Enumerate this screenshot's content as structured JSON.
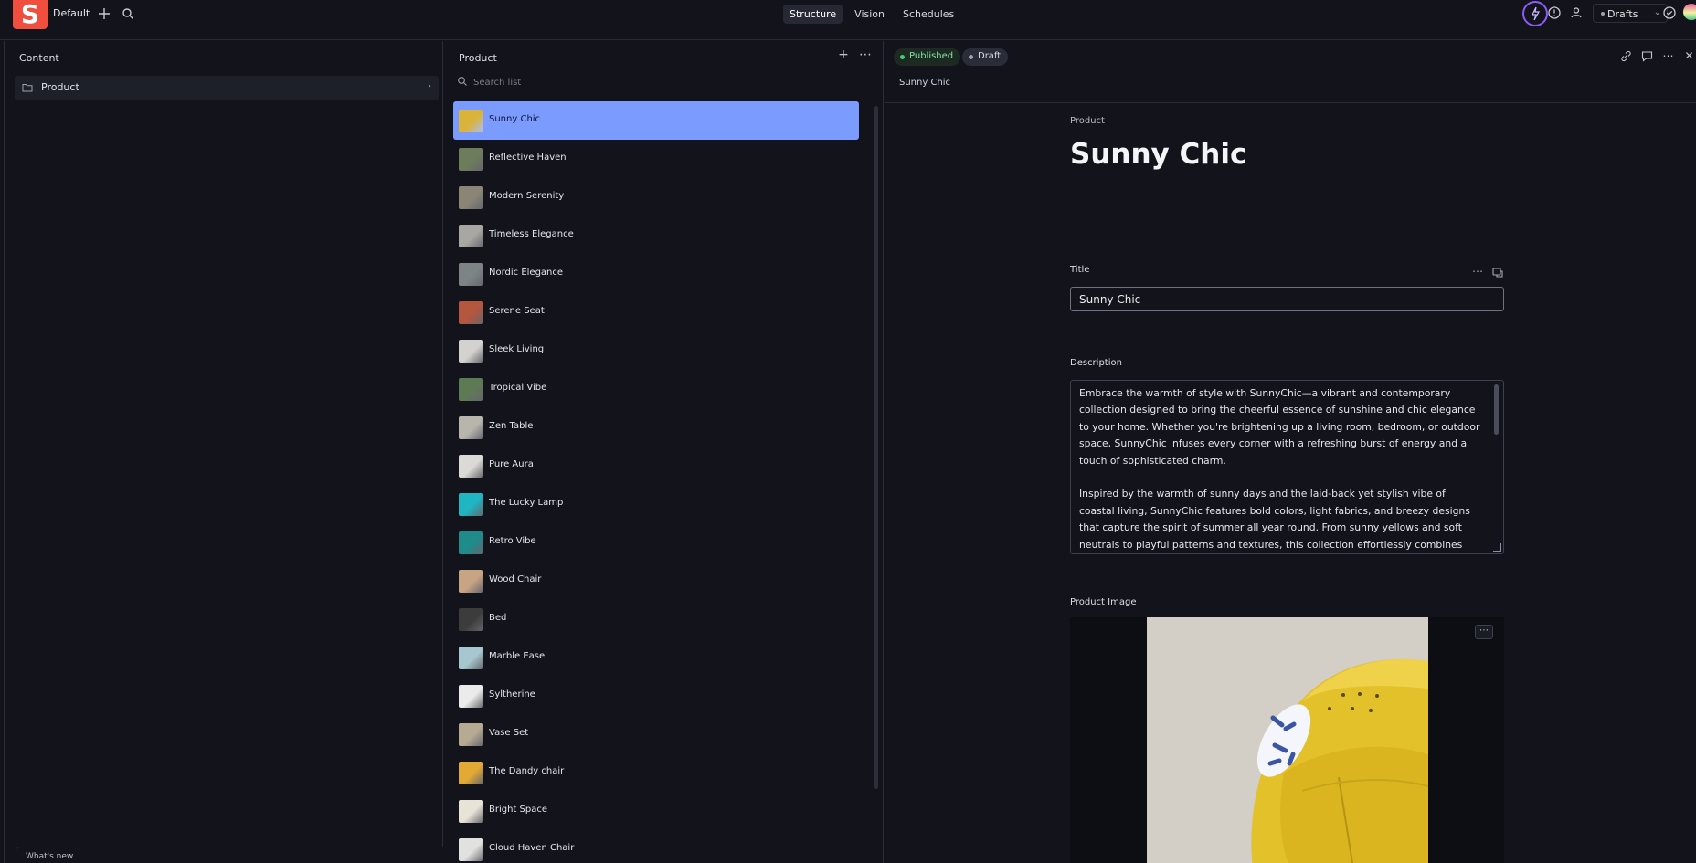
{
  "topbar": {
    "logo_letter": "S",
    "workspace": "Default",
    "tools": [
      {
        "label": "Structure",
        "active": true
      },
      {
        "label": "Vision",
        "active": false
      },
      {
        "label": "Schedules",
        "active": false
      }
    ],
    "perspective": "Drafts"
  },
  "content_pane": {
    "title": "Content",
    "items": [
      {
        "label": "Product"
      }
    ],
    "whats_new": "What's new"
  },
  "list_pane": {
    "title": "Product",
    "search_placeholder": "Search list",
    "documents": [
      {
        "label": "Sunny Chic",
        "selected": true,
        "thumb": "#d9b33a"
      },
      {
        "label": "Reflective Haven",
        "selected": false,
        "thumb": "#6d7d5c"
      },
      {
        "label": "Modern Serenity",
        "selected": false,
        "thumb": "#8a8577"
      },
      {
        "label": "Timeless Elegance",
        "selected": false,
        "thumb": "#a9a7a2"
      },
      {
        "label": "Nordic Elegance",
        "selected": false,
        "thumb": "#7c8486"
      },
      {
        "label": "Serene Seat",
        "selected": false,
        "thumb": "#b5563f"
      },
      {
        "label": "Sleek Living",
        "selected": false,
        "thumb": "#d3d2cf"
      },
      {
        "label": "Tropical Vibe",
        "selected": false,
        "thumb": "#5e7a55"
      },
      {
        "label": "Zen Table",
        "selected": false,
        "thumb": "#b8b5ad"
      },
      {
        "label": "Pure Aura",
        "selected": false,
        "thumb": "#dcdad6"
      },
      {
        "label": "The Lucky Lamp",
        "selected": false,
        "thumb": "#1fb5c2"
      },
      {
        "label": "Retro Vibe",
        "selected": false,
        "thumb": "#1f8b8a"
      },
      {
        "label": "Wood Chair",
        "selected": false,
        "thumb": "#c9a484"
      },
      {
        "label": "Bed",
        "selected": false,
        "thumb": "#3c3c3c"
      },
      {
        "label": "Marble Ease",
        "selected": false,
        "thumb": "#a6c7cf"
      },
      {
        "label": "Syltherine",
        "selected": false,
        "thumb": "#ebebeb"
      },
      {
        "label": "Vase Set",
        "selected": false,
        "thumb": "#b7aa93"
      },
      {
        "label": "The Dandy chair",
        "selected": false,
        "thumb": "#e2a935"
      },
      {
        "label": "Bright Space",
        "selected": false,
        "thumb": "#e8e3d7"
      },
      {
        "label": "Cloud Haven Chair",
        "selected": false,
        "thumb": "#e1e1df"
      }
    ]
  },
  "document": {
    "status_published": "Published",
    "status_draft": "Draft",
    "breadcrumb": "Sunny Chic",
    "type_label": "Product",
    "heading": "Sunny Chic",
    "title_label": "Title",
    "title_value": "Sunny Chic",
    "description_label": "Description",
    "description_value": "Embrace the warmth of style with SunnyChic—a vibrant and contemporary collection designed to bring the cheerful essence of sunshine and chic elegance to your home. Whether you're brightening up a living room, bedroom, or outdoor space, SunnyChic infuses every corner with a refreshing burst of energy and a touch of sophisticated charm.\n\nInspired by the warmth of sunny days and the laid-back yet stylish vibe of coastal living, SunnyChic features bold colors, light fabrics, and breezy designs that capture the spirit of summer all year round. From sunny yellows and soft neutrals to playful patterns and textures, this collection effortlessly combines comfort with",
    "image_label": "Product Image"
  },
  "colors": {
    "accent_selected": "#7b9bff",
    "brand": "#f04e3e",
    "published": "#3ecf74"
  }
}
